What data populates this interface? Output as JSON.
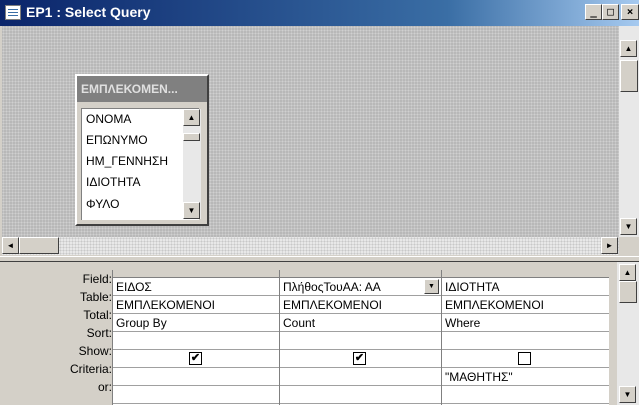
{
  "window": {
    "title": "EP1 : Select Query",
    "min_glyph": "_",
    "max_glyph": "□",
    "close_glyph": "×"
  },
  "field_list": {
    "title": "ΕΜΠΛΕΚΟΜΕΝ...",
    "items": [
      "ΟΝΟΜΑ",
      "ΕΠΩΝΥΜΟ",
      "ΗΜ_ΓΕΝΝΗΣΗ",
      "ΙΔΙΟΤΗΤΑ",
      "ΦΥΛΟ"
    ]
  },
  "scroll_glyphs": {
    "up": "▲",
    "down": "▼",
    "left": "◄",
    "right": "►"
  },
  "grid": {
    "row_labels": [
      "Field:",
      "Table:",
      "Total:",
      "Sort:",
      "Show:",
      "Criteria:",
      "or:"
    ],
    "columns": [
      {
        "field": "ΕΙΔΟΣ",
        "table": "ΕΜΠΛΕΚΟΜΕΝΟΙ",
        "total": "Group By",
        "sort": "",
        "show": true,
        "criteria": "",
        "or": ""
      },
      {
        "field": "ΠλήθοςΤουΑΑ: ΑΑ",
        "table": "ΕΜΠΛΕΚΟΜΕΝΟΙ",
        "total": "Count",
        "sort": "",
        "show": true,
        "criteria": "",
        "or": ""
      },
      {
        "field": "ΙΔΙΟΤΗΤΑ",
        "table": "ΕΜΠΛΕΚΟΜΕΝΟΙ",
        "total": "Where",
        "sort": "",
        "show": false,
        "criteria": "\"ΜΑΘΗΤΗΣ\"",
        "or": ""
      }
    ],
    "check_glyph": "✔"
  }
}
